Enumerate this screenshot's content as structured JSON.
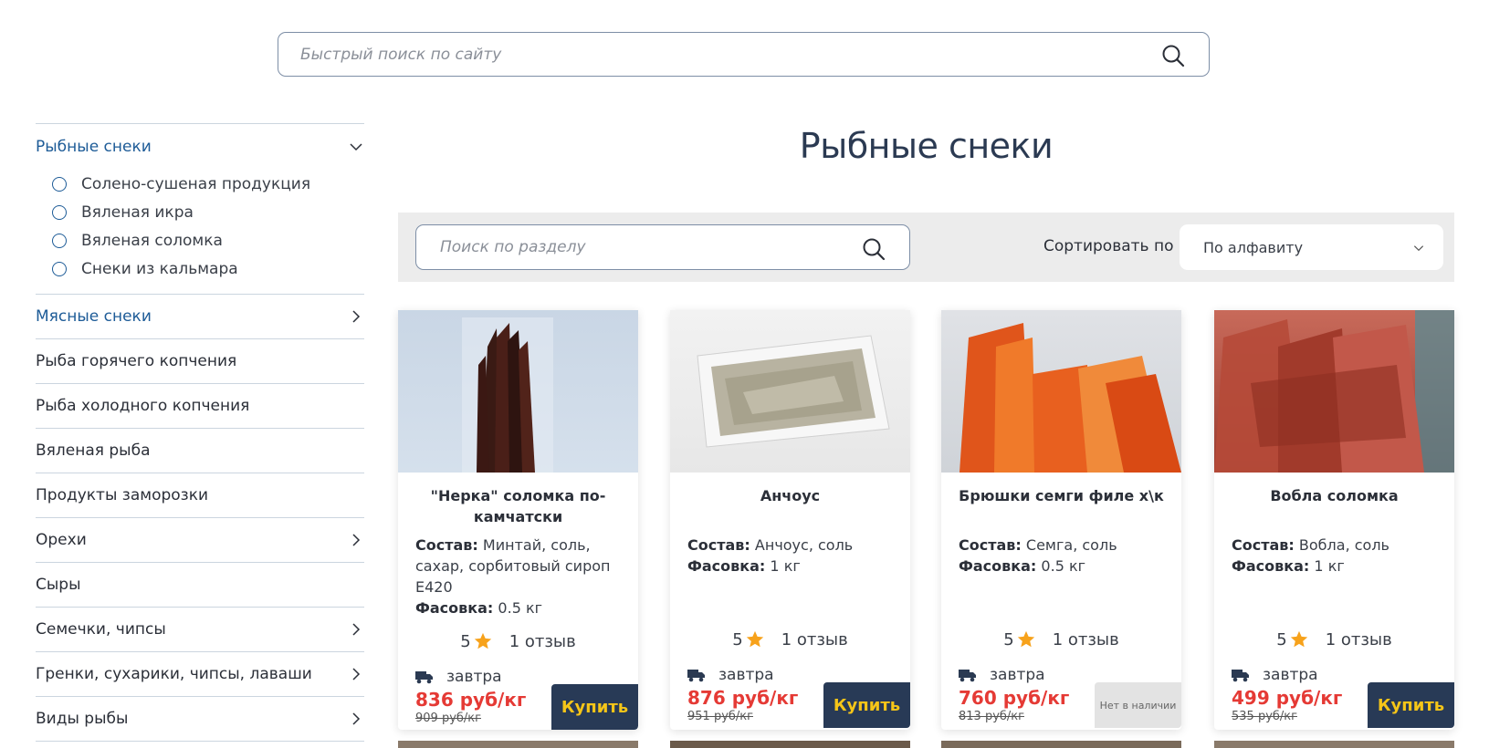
{
  "top_search": {
    "placeholder": "Быстрый поиск по сайту"
  },
  "sidebar": {
    "categories": [
      {
        "label": "Рыбные снеки",
        "expanded": true,
        "active": true,
        "subitems": [
          "Солено-сушеная продукция",
          "Вяленая икра",
          "Вяленая соломка",
          "Снеки из кальмара"
        ]
      },
      {
        "label": "Мясные снеки",
        "active": true,
        "has_children": true
      },
      {
        "label": "Рыба горячего копчения"
      },
      {
        "label": "Рыба холодного копчения"
      },
      {
        "label": "Вяленая рыба"
      },
      {
        "label": "Продукты заморозки"
      },
      {
        "label": "Орехи",
        "has_children": true
      },
      {
        "label": "Сыры"
      },
      {
        "label": "Семечки, чипсы",
        "has_children": true
      },
      {
        "label": "Гренки, сухарики, чипсы, лаваши",
        "has_children": true
      },
      {
        "label": "Виды рыбы",
        "has_children": true
      }
    ]
  },
  "page": {
    "title": "Рыбные снеки"
  },
  "filter": {
    "search_placeholder": "Поиск по разделу",
    "sort_label": "Сортировать по",
    "sort_value": "По алфавиту"
  },
  "labels": {
    "composition": "Состав:",
    "packaging": "Фасовка:"
  },
  "products": [
    {
      "title": "\"Нерка\" соломка по-камчатски",
      "composition": "Минтай, соль, сахар, сорбитовый сироп Е420",
      "packaging": "0.5 кг",
      "rating": "5",
      "reviews": "1 отзыв",
      "delivery": "завтра",
      "price": "836 руб/кг",
      "old_price": "909 руб/кг",
      "button": "Купить",
      "in_stock": true
    },
    {
      "title": "Анчоус",
      "composition": "Анчоус, соль",
      "packaging": "1 кг",
      "rating": "5",
      "reviews": "1 отзыв",
      "delivery": "завтра",
      "price": "876 руб/кг",
      "old_price": "951 руб/кг",
      "button": "Купить",
      "in_stock": true
    },
    {
      "title": "Брюшки семги филе х\\к",
      "composition": "Семга, соль",
      "packaging": "0.5 кг",
      "rating": "5",
      "reviews": "1 отзыв",
      "delivery": "завтра",
      "price": "760 руб/кг",
      "old_price": "813 руб/кг",
      "button": "Нет в наличии",
      "in_stock": false
    },
    {
      "title": "Вобла соломка",
      "composition": "Вобла, соль",
      "packaging": "1 кг",
      "rating": "5",
      "reviews": "1 отзыв",
      "delivery": "завтра",
      "price": "499 руб/кг",
      "old_price": "535 руб/кг",
      "button": "Купить",
      "in_stock": true
    }
  ],
  "colors": {
    "accent_blue": "#1d5b97",
    "price_red": "#e53a35",
    "button_bg": "#283a56",
    "button_text": "#f5c518",
    "star": "#f7a21b"
  }
}
